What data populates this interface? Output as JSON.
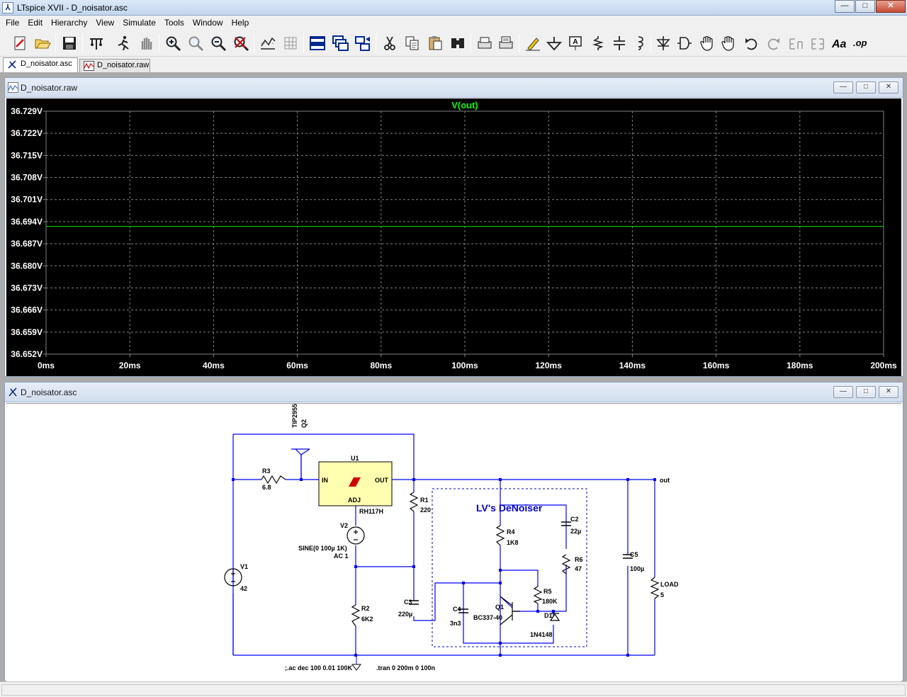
{
  "window": {
    "title": "LTspice XVII - D_noisator.asc",
    "min": "—",
    "max": "□",
    "close": "✕"
  },
  "menu": [
    "File",
    "Edit",
    "Hierarchy",
    "View",
    "Simulate",
    "Tools",
    "Window",
    "Help"
  ],
  "toolbar_icons": [
    "new-schematic-icon",
    "open-icon",
    "save-icon",
    "control-panel-icon",
    "run-icon",
    "halt-icon",
    "zoom-in-icon",
    "zoom-pan-icon",
    "zoom-out-icon",
    "zoom-fit-icon",
    "autorange-icon",
    "grid-icon",
    "tile-horizontal-icon",
    "cascade-icon",
    "tile-vertical-icon",
    "cut-icon",
    "copy-icon",
    "paste-icon",
    "find-icon",
    "print-setup-icon",
    "print-icon",
    "draw-wire-icon",
    "ground-icon",
    "label-net-icon",
    "resistor-icon",
    "capacitor-icon",
    "inductor-icon",
    "diode-icon",
    "component-icon",
    "move-icon",
    "drag-icon",
    "undo-icon",
    "redo-icon",
    "rotate-icon",
    "mirror-icon",
    "text-icon",
    "spice-directive-icon"
  ],
  "tabs": [
    {
      "label": "D_noisator.asc",
      "active": true
    },
    {
      "label": "D_noisator.raw",
      "active": false
    }
  ],
  "plot_window": {
    "title": "D_noisator.raw"
  },
  "schematic_window": {
    "title": "D_noisator.asc"
  },
  "child_buttons": {
    "min": "—",
    "max": "□",
    "close": "✕"
  },
  "colors": {
    "plot_bg": "#000000",
    "trace": "#00c000",
    "trace_label": "#00ff00",
    "grid": "#808080",
    "axis_text": "#ffffff",
    "wire": "#0000ff",
    "label": "#000000",
    "box_title": "#0000cc"
  },
  "chart_data": {
    "type": "line",
    "title": "V(out)",
    "series": [
      {
        "name": "V(out)",
        "x": [
          0,
          200
        ],
        "values": [
          36.6925,
          36.6925
        ]
      }
    ],
    "x_ticks": [
      "0ms",
      "20ms",
      "40ms",
      "60ms",
      "80ms",
      "100ms",
      "120ms",
      "140ms",
      "160ms",
      "180ms",
      "200ms"
    ],
    "y_ticks": [
      "36.729V",
      "36.722V",
      "36.715V",
      "36.708V",
      "36.701V",
      "36.694V",
      "36.687V",
      "36.680V",
      "36.673V",
      "36.666V",
      "36.659V",
      "36.652V"
    ],
    "xlim": [
      0,
      200
    ],
    "ylim": [
      36.652,
      36.729
    ],
    "grid": true,
    "xlabel": "",
    "ylabel": ""
  },
  "schematic": {
    "components": [
      {
        "ref": "Q2",
        "value": "TIP2955"
      },
      {
        "ref": "R3",
        "value": "6.8"
      },
      {
        "ref": "U1",
        "value": "RH117H",
        "pins": {
          "in": "IN",
          "out": "OUT",
          "adj": "ADJ"
        }
      },
      {
        "ref": "R1",
        "value": "220"
      },
      {
        "ref": "V2",
        "value": "SINE(0 100µ 1K)",
        "extra": "AC 1"
      },
      {
        "ref": "V1",
        "value": "42"
      },
      {
        "ref": "R2",
        "value": "6K2"
      },
      {
        "ref": "C3",
        "value": "220µ"
      },
      {
        "ref": "R4",
        "value": "1K8"
      },
      {
        "ref": "C2",
        "value": "22µ"
      },
      {
        "ref": "R6",
        "value": "47"
      },
      {
        "ref": "R5",
        "value": "180K"
      },
      {
        "ref": "C4",
        "value": "3n3"
      },
      {
        "ref": "Q1",
        "value": "BC337-40"
      },
      {
        "ref": "D1",
        "value": "1N4148"
      },
      {
        "ref": "C5",
        "value": "100µ"
      },
      {
        "ref": "LOAD",
        "value": "5"
      }
    ],
    "net_label": "out",
    "box_title": "LV's DeNoiser",
    "directives": [
      ";.ac dec 100 0.01 100K",
      ".tran 0 200m 0 100n"
    ]
  }
}
